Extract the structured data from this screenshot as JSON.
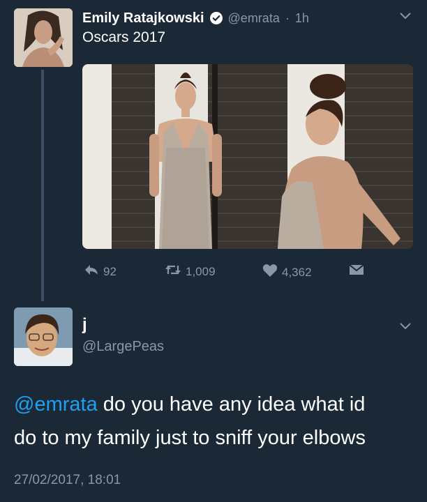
{
  "tweet1": {
    "display_name": "Emily Ratajkowski",
    "handle": "@emrata",
    "separator": "·",
    "time": "1h",
    "text": "Oscars 2017",
    "actions": {
      "replies": "92",
      "retweets": "1,009",
      "likes": "4,362"
    }
  },
  "tweet2": {
    "display_name": "j",
    "handle": "@LargePeas",
    "mention": "@emrata",
    "text_line1": " do you have any idea what id",
    "text_line2": "do to my family just to sniff your elbows",
    "timestamp": "27/02/2017, 18:01"
  },
  "icons": {
    "verified": "verified-badge-icon",
    "caret": "chevron-down-icon",
    "reply": "reply-icon",
    "retweet": "retweet-icon",
    "like": "heart-icon",
    "dm": "envelope-icon"
  },
  "colors": {
    "background": "#1b2836",
    "muted": "#8899a6",
    "link": "#1da1f2",
    "thread_line": "#3c4f63"
  }
}
